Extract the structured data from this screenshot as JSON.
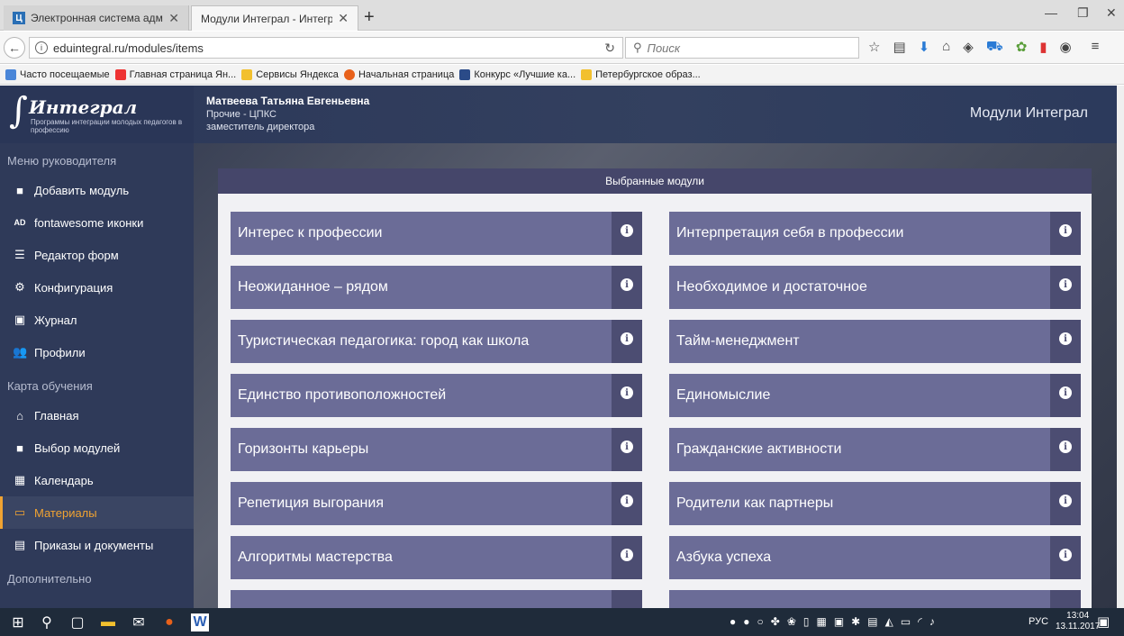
{
  "browser": {
    "tabs": [
      {
        "label": "Электронная система адми",
        "favicon": "Ц"
      },
      {
        "label": "Модули Интеграл - Интеграл"
      }
    ],
    "url": "eduintegral.ru/modules/items",
    "search_placeholder": "Поиск",
    "bookmarks": [
      "Часто посещаемые",
      "Главная страница Ян...",
      "Сервисы Яндекса",
      "Начальная страница",
      "Конкурс «Лучшие ка...",
      "Петербургское образ..."
    ]
  },
  "app": {
    "logo_name": "Интеграл",
    "logo_sub": "Программы интеграции молодых педагогов в профессию",
    "user_name": "Матвеева Татьяна Евгеньевна",
    "user_org": "Прочие - ЦПКС",
    "user_role": "заместитель директора",
    "header_title": "Модули Интеграл",
    "panel_title": "Выбранные модули"
  },
  "sidebar": {
    "sections": [
      "Меню руководителя",
      "Карта обучения",
      "Дополнительно"
    ],
    "items": [
      {
        "label": "Добавить модуль",
        "icon": "th-large-icon"
      },
      {
        "label": "fontawesome иконки",
        "icon": "font-awesome-icon"
      },
      {
        "label": "Редактор форм",
        "icon": "list-icon"
      },
      {
        "label": "Конфигурация",
        "icon": "cogs-icon"
      },
      {
        "label": "Журнал",
        "icon": "address-book-icon"
      },
      {
        "label": "Профили",
        "icon": "users-icon"
      },
      {
        "label": "Главная",
        "icon": "home-icon"
      },
      {
        "label": "Выбор модулей",
        "icon": "th-large-icon"
      },
      {
        "label": "Календарь",
        "icon": "calendar-icon"
      },
      {
        "label": "Материалы",
        "icon": "folder-open-icon"
      },
      {
        "label": "Приказы и документы",
        "icon": "file-text-icon"
      }
    ]
  },
  "modules": [
    "Интерес к профессии",
    "Интерпретация себя в профессии",
    "Неожиданное – рядом",
    "Необходимое и достаточное",
    "Туристическая педагогика: город как школа",
    "Тайм-менеджмент",
    "Единство противоположностей",
    "Единомыслие",
    "Горизонты карьеры",
    "Гражданские активности",
    "Репетиция выгорания",
    "Родители как партнеры",
    "Алгоритмы мастерства",
    "Азбука успеха"
  ],
  "taskbar": {
    "lang": "РУС",
    "time": "13:04",
    "date": "13.11.2017"
  },
  "colors": {
    "accent": "#f0a332",
    "sidebar": "#2f3a59",
    "module": "#6b6c97",
    "module_info": "#4c4d72"
  }
}
